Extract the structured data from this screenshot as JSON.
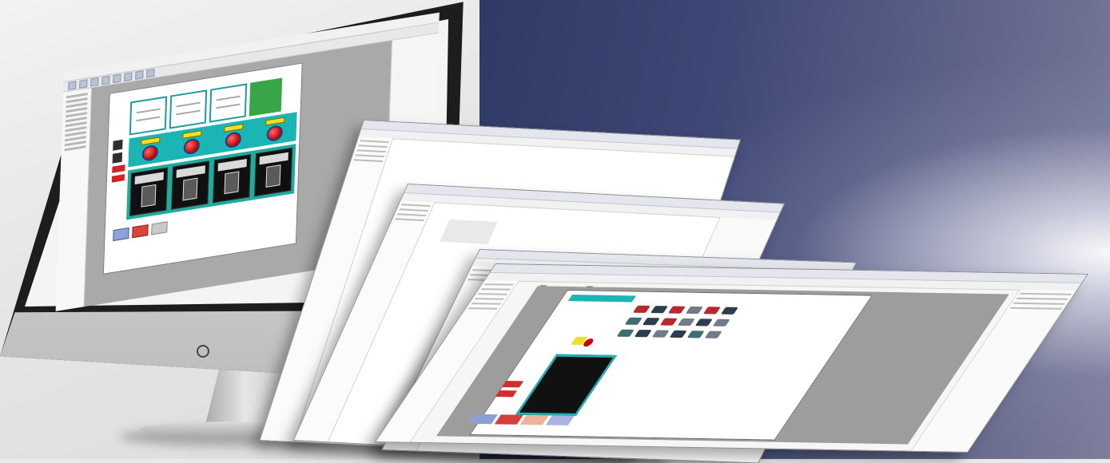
{
  "scene": {
    "description": "",
    "colors": {
      "background_left": "#e9e9e9",
      "background_right": "#3e4775",
      "canvas_accent": "#1bb5b5",
      "button_red": "#c40000",
      "label_yellow": "#f0de2a",
      "tile_green": "#38a648"
    }
  },
  "monitor": {
    "window": {
      "menu_items": [
        "",
        "",
        "",
        "",
        "",
        ""
      ],
      "canvas_title": ""
    },
    "icons": [
      "power-button-icon"
    ]
  },
  "stacked_windows": {
    "count": 4,
    "front_window": {
      "tab_1": "",
      "tab_2": ""
    }
  }
}
